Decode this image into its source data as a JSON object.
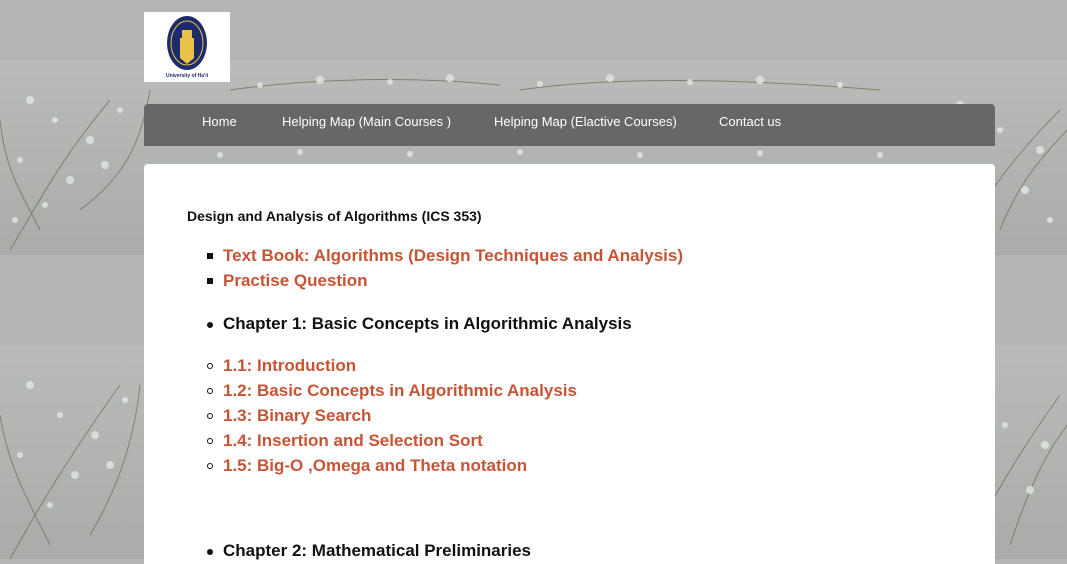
{
  "logo": {
    "caption": "University of Ha'il"
  },
  "nav": {
    "items": [
      {
        "label": "Home"
      },
      {
        "label": "Helping Map (Main Courses )"
      },
      {
        "label": "Helping Map (Elactive Courses)"
      },
      {
        "label": "Contact us"
      }
    ]
  },
  "content": {
    "course_title": "Design and Analysis of Algorithms (ICS 353)",
    "resources": [
      "Text Book: Algorithms (Design Techniques and Analysis)",
      "Practise Question"
    ],
    "chapter1": {
      "title": "Chapter 1: Basic Concepts in Algorithmic Analysis",
      "sections": [
        "1.1: Introduction",
        "1.2: Basic Concepts in Algorithmic Analysis",
        "1.3: Binary Search",
        "1.4: Insertion and Selection Sort",
        "1.5: Big-O ,Omega and Theta notation"
      ]
    },
    "chapter2": {
      "title": "Chapter 2: Mathematical Preliminaries"
    }
  },
  "colors": {
    "link": "#c75435",
    "navbar": "#666766",
    "background": "#b3b6b3"
  }
}
